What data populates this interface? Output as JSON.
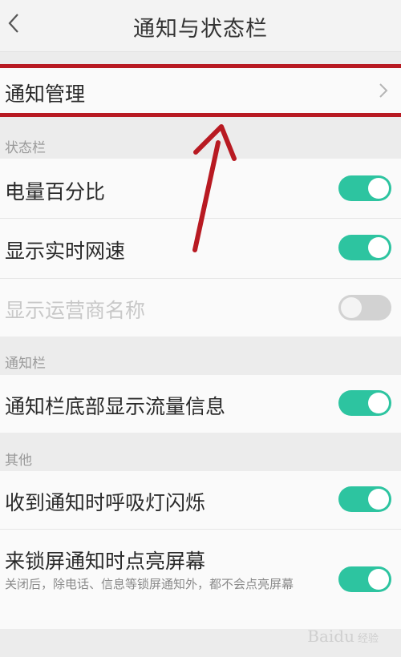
{
  "header": {
    "title": "通知与状态栏"
  },
  "notification_management": {
    "label": "通知管理"
  },
  "status_bar_section": {
    "title": "状态栏",
    "items": [
      {
        "label": "电量百分比",
        "enabled": true,
        "disabled": false
      },
      {
        "label": "显示实时网速",
        "enabled": true,
        "disabled": false
      },
      {
        "label": "显示运营商名称",
        "enabled": false,
        "disabled": true
      }
    ]
  },
  "notification_bar_section": {
    "title": "通知栏",
    "items": [
      {
        "label": "通知栏底部显示流量信息",
        "enabled": true
      }
    ]
  },
  "other_section": {
    "title": "其他",
    "items": [
      {
        "label": "收到通知时呼吸灯闪烁",
        "enabled": true
      },
      {
        "label": "来锁屏通知时点亮屏幕",
        "enabled": true,
        "description": "关闭后，除电话、信息等锁屏通知外，都不会点亮屏幕"
      }
    ]
  },
  "watermark": {
    "brand": "Baidu",
    "sub": "经验"
  },
  "colors": {
    "toggle_on": "#2dc4a0",
    "toggle_off": "#d2d2d2",
    "highlight": "#b81a22"
  }
}
